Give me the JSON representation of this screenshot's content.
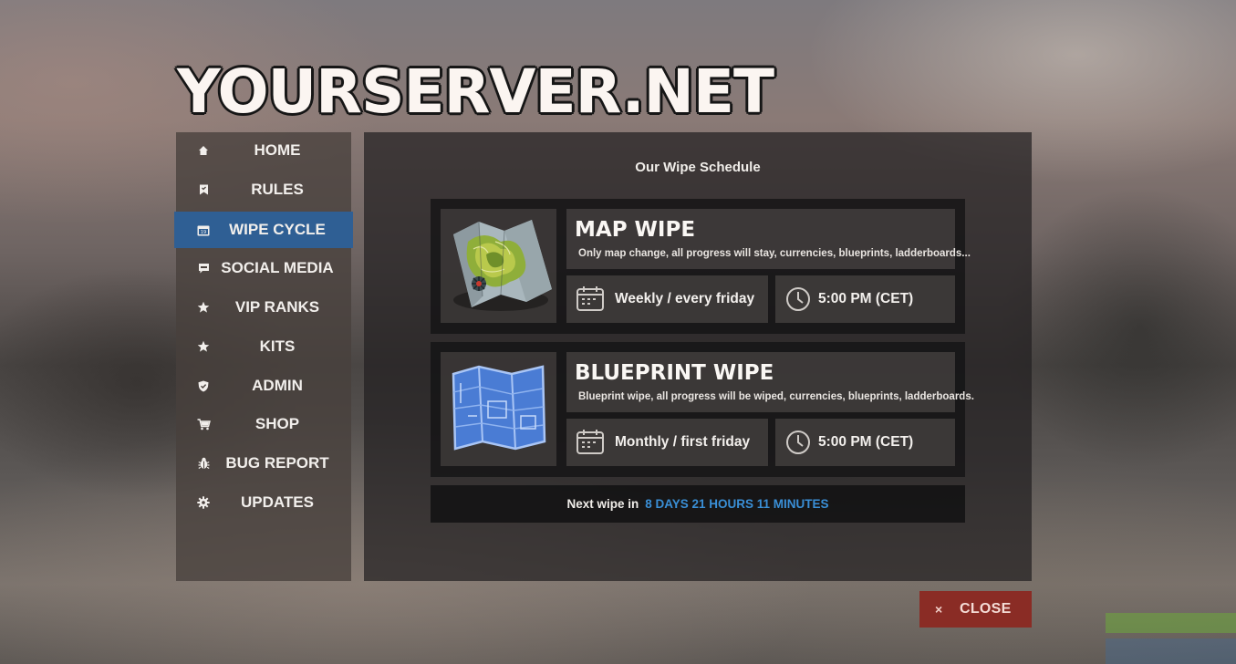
{
  "server": {
    "title": "YOURSERVER.NET"
  },
  "sidebar": {
    "items": [
      {
        "label": "HOME",
        "icon": "home-icon",
        "active": false
      },
      {
        "label": "RULES",
        "icon": "bookmark-icon",
        "active": false
      },
      {
        "label": "WIPE CYCLE",
        "icon": "calendar-icon",
        "active": true
      },
      {
        "label": "SOCIAL MEDIA",
        "icon": "chat-icon",
        "active": false
      },
      {
        "label": "VIP RANKS",
        "icon": "star-icon",
        "active": false
      },
      {
        "label": "KITS",
        "icon": "star-icon",
        "active": false
      },
      {
        "label": "ADMIN",
        "icon": "shield-icon",
        "active": false
      },
      {
        "label": "SHOP",
        "icon": "cart-icon",
        "active": false
      },
      {
        "label": "BUG REPORT",
        "icon": "bug-icon",
        "active": false
      },
      {
        "label": "UPDATES",
        "icon": "gear-icon",
        "active": false
      }
    ]
  },
  "main": {
    "title": "Our Wipe Schedule",
    "wipes": [
      {
        "name": "MAP WIPE",
        "description": "Only map change, all progress will stay, currencies, blueprints, ladderboards...",
        "frequency": "Weekly / every friday",
        "time": "5:00 PM (CET)",
        "image": "map-icon"
      },
      {
        "name": "BLUEPRINT WIPE",
        "description": "Blueprint wipe, all progress will be wiped, currencies, blueprints, ladderboards.",
        "frequency": "Monthly / first friday",
        "time": "5:00 PM (CET)",
        "image": "blueprint-icon"
      }
    ],
    "next_wipe": {
      "label": "Next wipe in",
      "value": "8 DAYS 21 HOURS 11 MINUTES"
    }
  },
  "close": {
    "x": "×",
    "label": "CLOSE"
  },
  "colors": {
    "active_nav": "#2f5f94",
    "countdown": "#3a8fd6",
    "close_button": "#8a2c25"
  }
}
